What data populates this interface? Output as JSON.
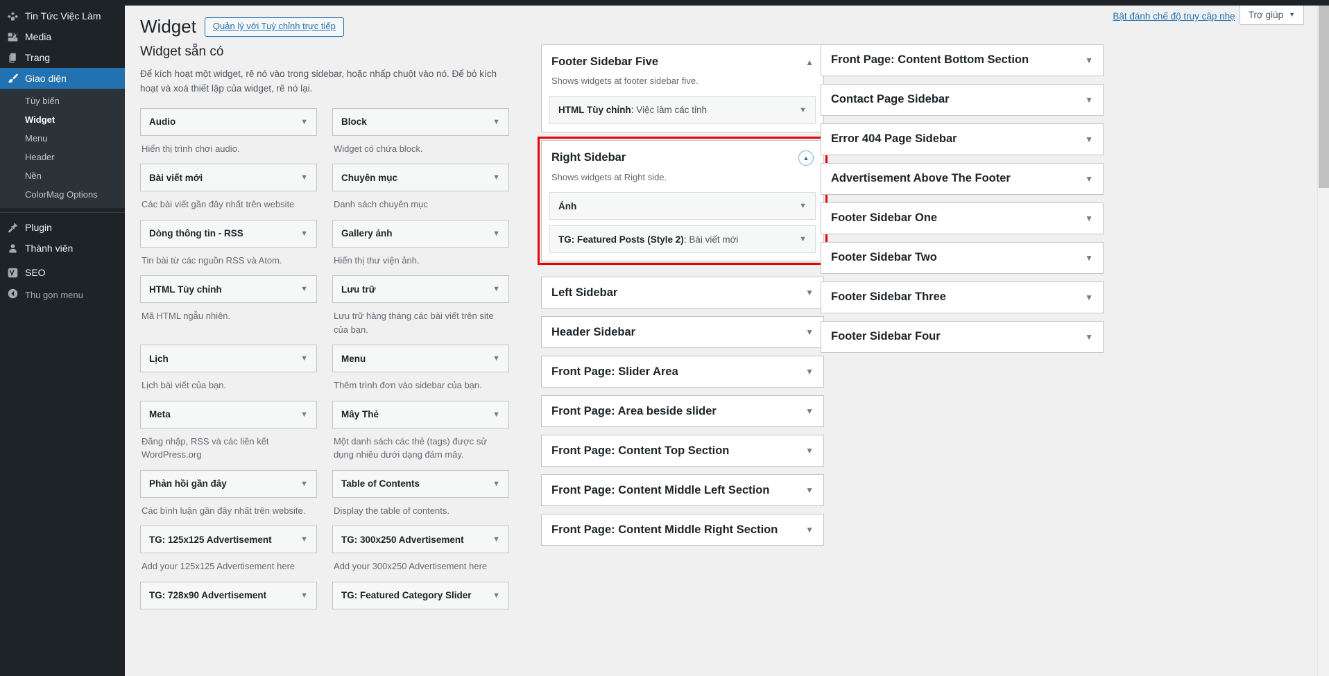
{
  "admin_menu": {
    "items": [
      {
        "label": "Tin Tức Việc Làm",
        "icon": "site-icon",
        "current": false
      },
      {
        "label": "Media",
        "icon": "media-icon",
        "current": false
      },
      {
        "label": "Trang",
        "icon": "pages-icon",
        "current": false
      },
      {
        "label": "Giao diện",
        "icon": "appearance-brush-icon",
        "current": true
      }
    ],
    "submenu": [
      {
        "label": "Tùy biến",
        "current": false
      },
      {
        "label": "Widget",
        "current": true
      },
      {
        "label": "Menu",
        "current": false
      },
      {
        "label": "Header",
        "current": false
      },
      {
        "label": "Nền",
        "current": false
      },
      {
        "label": "ColorMag Options",
        "current": false
      }
    ],
    "items_bottom": [
      {
        "label": "Plugin",
        "icon": "plugin-icon"
      },
      {
        "label": "Thành viên",
        "icon": "users-icon"
      },
      {
        "label": "SEO",
        "icon": "yoast-seo-icon"
      }
    ],
    "collapse": {
      "label": "Thu gọn menu",
      "icon": "collapse-arrow-icon"
    }
  },
  "screen_meta": {
    "accessibility_link": "Bật đánh chế độ truy cập nhẹ",
    "help_label": "Trợ giúp",
    "help_caret": "▼"
  },
  "header": {
    "title": "Widget",
    "customize_button": "Quản lý với Tuỳ chỉnh trực tiếp"
  },
  "available": {
    "title": "Widget sẵn có",
    "description": "Để kích hoạt một widget, rê nó vào trong sidebar, hoặc nhấp chuột vào nó. Để bỏ kích hoạt và xoá thiết lập của widget, rê nó lại.",
    "widgets": [
      {
        "name": "Audio",
        "desc": "Hiển thị trình chơi audio."
      },
      {
        "name": "Block",
        "desc": "Widget có chứa block."
      },
      {
        "name": "Bài viết mới",
        "desc": "Các bài viết gần đây nhất trên website"
      },
      {
        "name": "Chuyên mục",
        "desc": "Danh sách chuyên mục"
      },
      {
        "name": "Dòng thông tin - RSS",
        "desc": "Tin bài từ các nguồn RSS và Atom."
      },
      {
        "name": "Gallery ảnh",
        "desc": "Hiển thị thư viện ảnh."
      },
      {
        "name": "HTML Tùy chỉnh",
        "desc": "Mã HTML ngẫu nhiên."
      },
      {
        "name": "Lưu trữ",
        "desc": "Lưu trữ hàng tháng các bài viết trên site của bạn."
      },
      {
        "name": "Lịch",
        "desc": "Lịch bài viết của bạn."
      },
      {
        "name": "Menu",
        "desc": "Thêm trình đơn vào sidebar của bạn."
      },
      {
        "name": "Meta",
        "desc": "Đăng nhập, RSS và các liên kết WordPress.org"
      },
      {
        "name": "Mây Thẻ",
        "desc": "Một danh sách các thẻ (tags) được sử dụng nhiều dưới dạng đám mây."
      },
      {
        "name": "Phản hồi gần đây",
        "desc": "Các bình luận gần đây nhất trên website."
      },
      {
        "name": "Table of Contents",
        "desc": "Display the table of contents."
      },
      {
        "name": "TG: 125x125 Advertisement",
        "desc": "Add your 125x125 Advertisement here"
      },
      {
        "name": "TG: 300x250 Advertisement",
        "desc": "Add your 300x250 Advertisement here"
      },
      {
        "name": "TG: 728x90 Advertisement",
        "desc": ""
      },
      {
        "name": "TG: Featured Category Slider",
        "desc": ""
      }
    ]
  },
  "sidebars_middle": [
    {
      "name": "Footer Sidebar Five",
      "description": "Shows widgets at footer sidebar five.",
      "expanded": true,
      "highlighted": false,
      "toggle_icon": "chevron-up-icon",
      "widgets": [
        {
          "type": "HTML Tùy chỉnh",
          "instance": "Việc làm các tỉnh"
        }
      ]
    },
    {
      "name": "Right Sidebar",
      "description": "Shows widgets at Right side.",
      "expanded": true,
      "highlighted": true,
      "toggle_icon": "chevron-up-circle-icon",
      "widgets": [
        {
          "type": "Ảnh",
          "instance": ""
        },
        {
          "type": "TG: Featured Posts (Style 2)",
          "instance": "Bài viết mới"
        }
      ]
    },
    {
      "name": "Left Sidebar",
      "description": "",
      "expanded": false,
      "highlighted": false,
      "toggle_icon": "chevron-down-icon",
      "widgets": []
    },
    {
      "name": "Header Sidebar",
      "description": "",
      "expanded": false,
      "highlighted": false,
      "toggle_icon": "chevron-down-icon",
      "widgets": []
    },
    {
      "name": "Front Page: Slider Area",
      "description": "",
      "expanded": false,
      "highlighted": false,
      "toggle_icon": "chevron-down-icon",
      "widgets": []
    },
    {
      "name": "Front Page: Area beside slider",
      "description": "",
      "expanded": false,
      "highlighted": false,
      "toggle_icon": "chevron-down-icon",
      "widgets": []
    },
    {
      "name": "Front Page: Content Top Section",
      "description": "",
      "expanded": false,
      "highlighted": false,
      "toggle_icon": "chevron-down-icon",
      "widgets": []
    },
    {
      "name": "Front Page: Content Middle Left Section",
      "description": "",
      "expanded": false,
      "highlighted": false,
      "toggle_icon": "chevron-down-icon",
      "widgets": []
    },
    {
      "name": "Front Page: Content Middle Right Section",
      "description": "",
      "expanded": false,
      "highlighted": false,
      "toggle_icon": "chevron-down-icon",
      "widgets": []
    }
  ],
  "sidebars_right": [
    {
      "name": "Front Page: Content Bottom Section",
      "toggle_icon": "chevron-down-icon"
    },
    {
      "name": "Contact Page Sidebar",
      "toggle_icon": "chevron-down-icon"
    },
    {
      "name": "Error 404 Page Sidebar",
      "toggle_icon": "chevron-down-icon"
    },
    {
      "name": "Advertisement Above The Footer",
      "toggle_icon": "chevron-down-icon"
    },
    {
      "name": "Footer Sidebar One",
      "toggle_icon": "chevron-down-icon"
    },
    {
      "name": "Footer Sidebar Two",
      "toggle_icon": "chevron-down-icon"
    },
    {
      "name": "Footer Sidebar Three",
      "toggle_icon": "chevron-down-icon"
    },
    {
      "name": "Footer Sidebar Four",
      "toggle_icon": "chevron-down-icon"
    }
  ],
  "colors": {
    "accent": "#2271b1",
    "menu_bg": "#1d2327",
    "highlight": "#e60000"
  }
}
